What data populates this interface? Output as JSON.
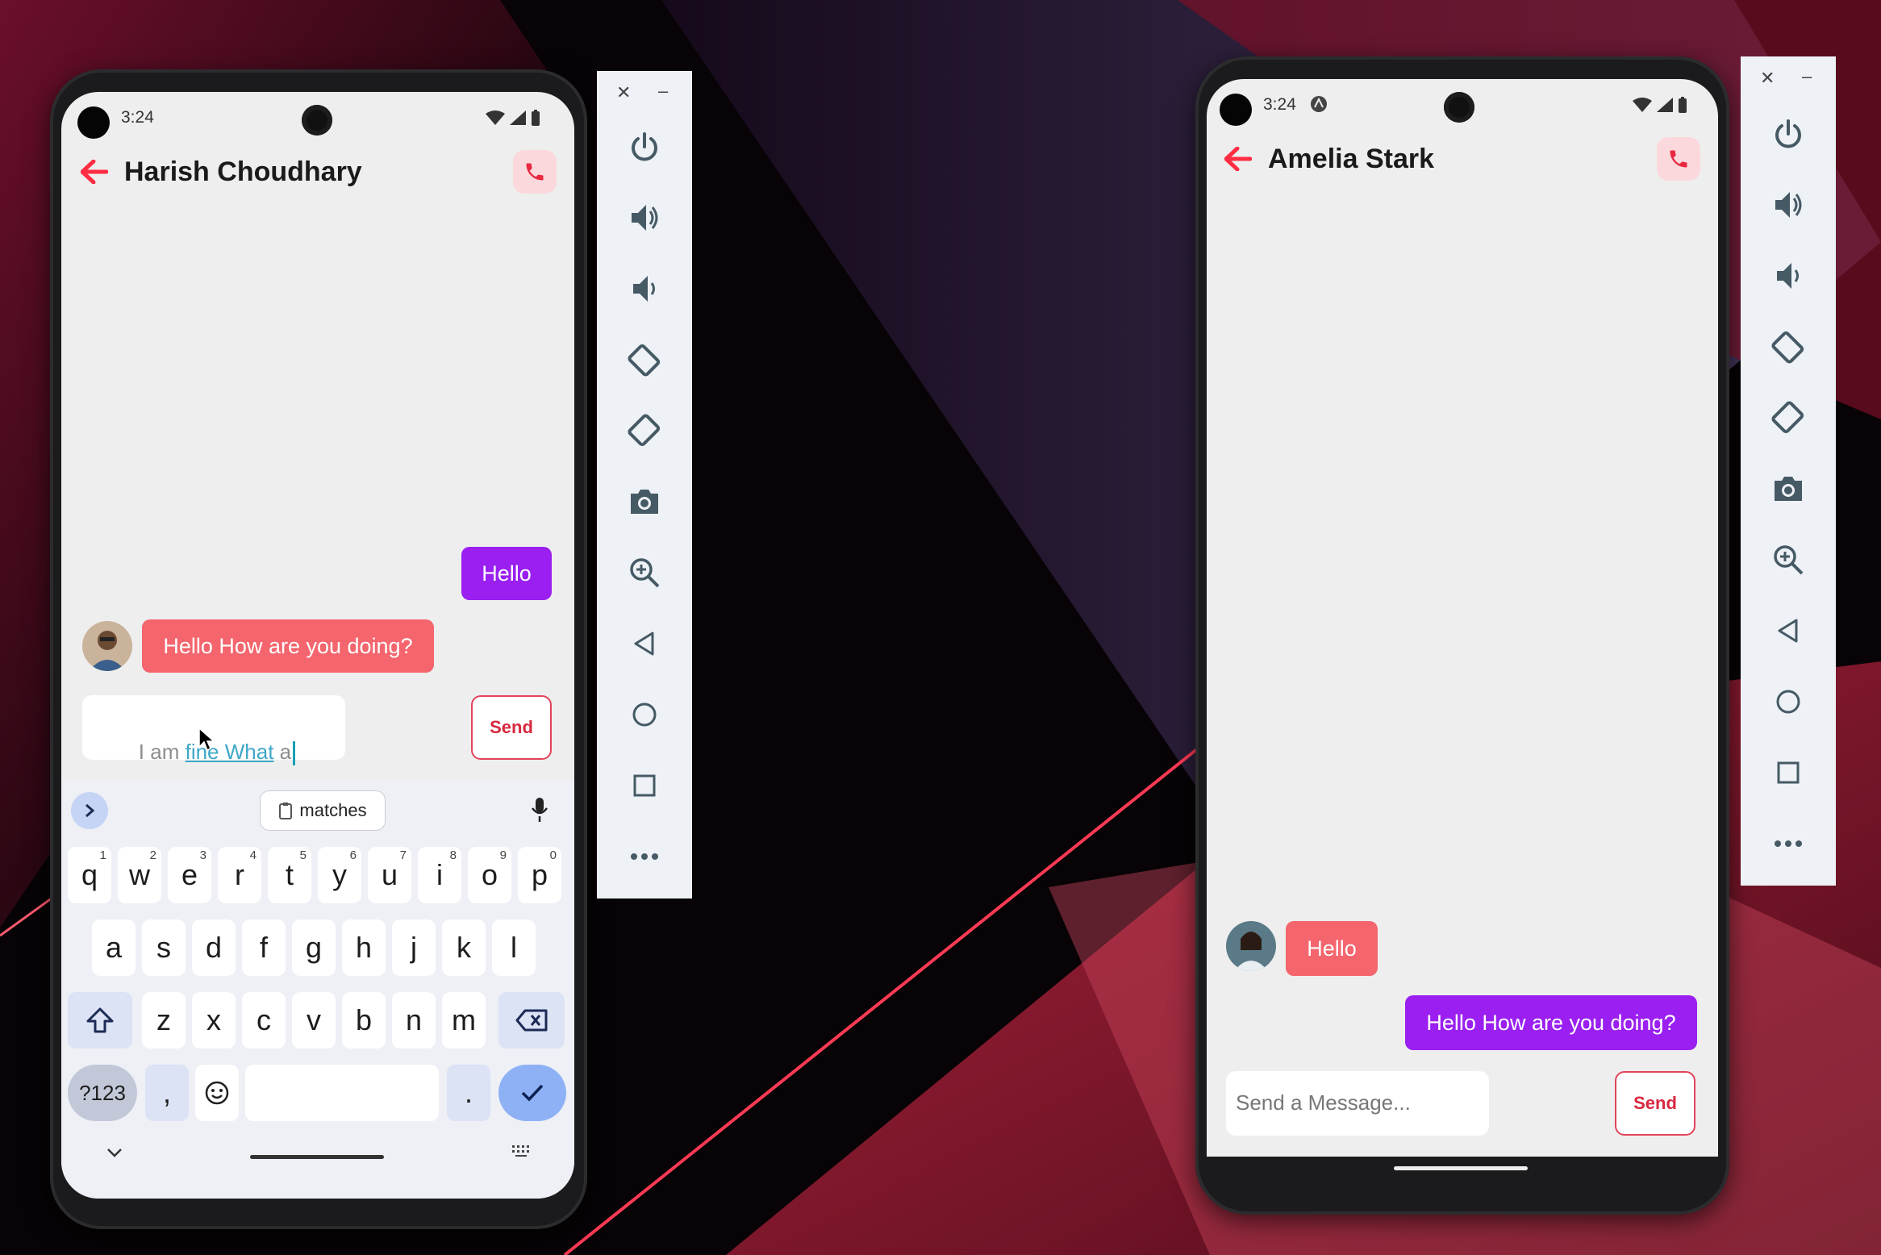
{
  "left_device": {
    "status": {
      "time": "3:24"
    },
    "header": {
      "contact_name": "Harish Choudhary",
      "back_icon": "arrow-left-icon",
      "call_icon": "phone-icon"
    },
    "messages": [
      {
        "direction": "outgoing",
        "text": "Hello"
      },
      {
        "direction": "incoming",
        "text": "Hello How are you doing?"
      }
    ],
    "composer": {
      "value_prefix": "I am ",
      "value_underlined": "fine What",
      "value_suffix": " a",
      "send_label": "Send"
    },
    "keyboard": {
      "suggestion": "matches",
      "row1": [
        {
          "k": "q",
          "s": "1"
        },
        {
          "k": "w",
          "s": "2"
        },
        {
          "k": "e",
          "s": "3"
        },
        {
          "k": "r",
          "s": "4"
        },
        {
          "k": "t",
          "s": "5"
        },
        {
          "k": "y",
          "s": "6"
        },
        {
          "k": "u",
          "s": "7"
        },
        {
          "k": "i",
          "s": "8"
        },
        {
          "k": "o",
          "s": "9"
        },
        {
          "k": "p",
          "s": "0"
        }
      ],
      "row2": [
        "a",
        "s",
        "d",
        "f",
        "g",
        "h",
        "j",
        "k",
        "l"
      ],
      "row3": [
        "z",
        "x",
        "c",
        "v",
        "b",
        "n",
        "m"
      ],
      "symbols_label": "?123",
      "comma_label": ",",
      "period_label": "."
    }
  },
  "right_device": {
    "status": {
      "time": "3:24"
    },
    "header": {
      "contact_name": "Amelia Stark",
      "back_icon": "arrow-left-icon",
      "call_icon": "phone-icon"
    },
    "messages": [
      {
        "direction": "incoming",
        "text": "Hello"
      },
      {
        "direction": "outgoing",
        "text": "Hello How are you doing?"
      }
    ],
    "composer": {
      "placeholder": "Send a Message...",
      "send_label": "Send"
    }
  },
  "emulator_toolbar": {
    "close": "✕",
    "minimize": "–",
    "buttons": [
      "power-icon",
      "volume-up-icon",
      "volume-down-icon",
      "rotate-left-icon",
      "rotate-right-icon",
      "camera-icon",
      "zoom-in-icon",
      "back-icon",
      "home-icon",
      "overview-icon",
      "more-icon"
    ]
  },
  "colors": {
    "accent_red": "#ff2d43",
    "outgoing_bubble": "#9a1ff0",
    "incoming_bubble": "#f4656d",
    "send_border": "#e2445a"
  }
}
